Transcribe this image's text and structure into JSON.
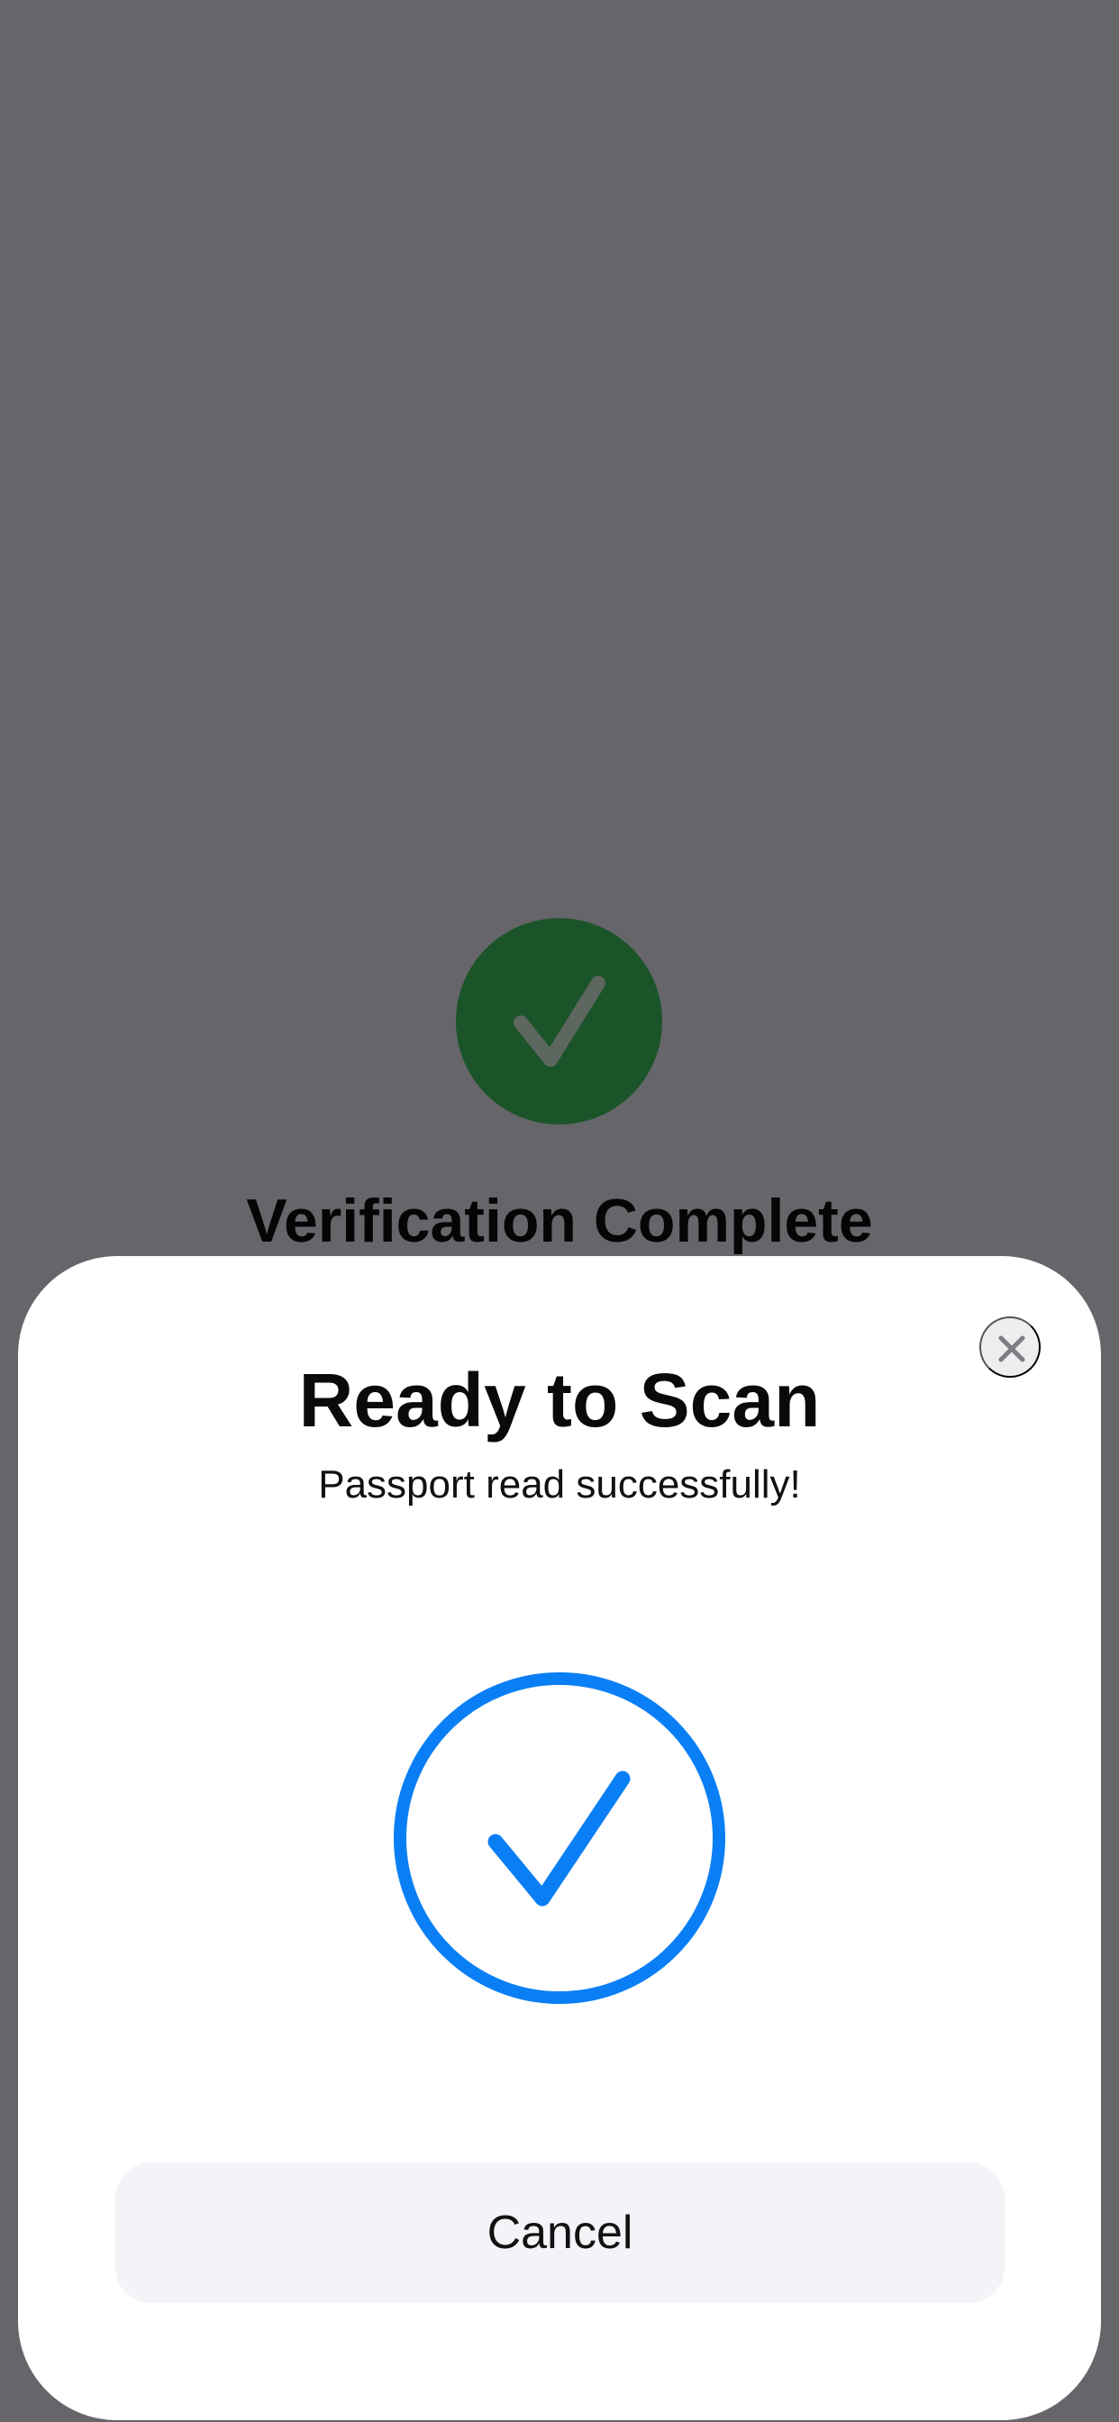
{
  "background": {
    "status_title": "Verification Complete",
    "status_icon": "checkmark-circle-icon",
    "status_color": "#1b5429"
  },
  "sheet": {
    "title": "Ready to Scan",
    "subtitle": "Passport read successfully!",
    "close_icon": "close-icon",
    "success_icon": "checkmark-circle-outline-icon",
    "accent_color": "#0a7ff5",
    "cancel_label": "Cancel"
  }
}
